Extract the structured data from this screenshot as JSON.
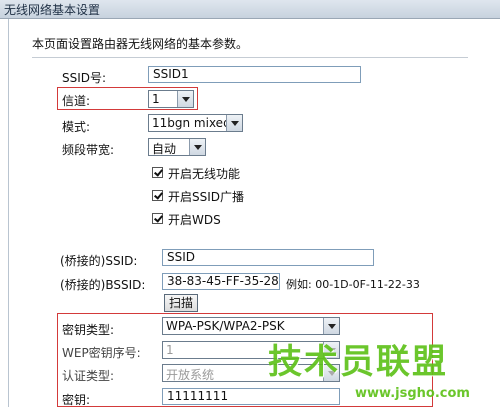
{
  "window": {
    "title": "无线网络基本设置"
  },
  "intro": "本页面设置路由器无线网络的基本参数。",
  "ssid": {
    "label": "SSID号:",
    "value": "SSID1"
  },
  "channel": {
    "label": "信道:",
    "value": "1"
  },
  "mode": {
    "label": "模式:",
    "value": "11bgn mixed"
  },
  "bandwidth": {
    "label": "频段带宽:",
    "value": "自动"
  },
  "options": {
    "enable_wireless": {
      "label": "开启无线功能",
      "checked": true
    },
    "ssid_broadcast": {
      "label": "开启SSID广播",
      "checked": true
    },
    "enable_wds": {
      "label": "开启WDS",
      "checked": true
    }
  },
  "bridge": {
    "ssid_label": "(桥接的)SSID:",
    "ssid_value": "SSID",
    "bssid_label": "(桥接的)BSSID:",
    "bssid_value": "38-83-45-FF-35-28",
    "example": "例如: 00-1D-0F-11-22-33",
    "scan_button": "扫描"
  },
  "security": {
    "key_type_label": "密钥类型:",
    "key_type_value": "WPA-PSK/WPA2-PSK",
    "wep_index_label": "WEP密钥序号:",
    "wep_index_value": "1",
    "auth_type_label": "认证类型:",
    "auth_type_value": "开放系统",
    "key_label": "密钥:",
    "key_value": "11111111"
  },
  "watermark": {
    "brand": "技术员联盟",
    "url": "www.jsgho.com"
  },
  "colors": {
    "highlight": "#d33a3a",
    "watermark": "#5fc21b"
  }
}
